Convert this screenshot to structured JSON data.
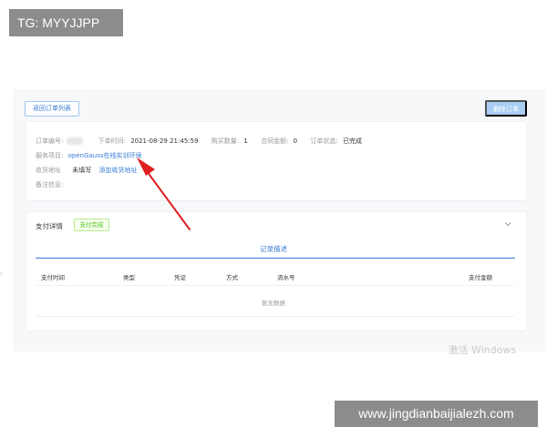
{
  "overlay": {
    "tg_label": "TG: MYYJJPP",
    "url_label": "www.jingdianbaijialezh.com",
    "windows_watermark": "激活 Windows"
  },
  "header": {
    "back_button": "返回订单列表",
    "delete_button": "删除订单"
  },
  "order": {
    "order_no_label": "订单编号:",
    "order_time_label": "下单时间:",
    "order_time_value": "2021-08-29 21:45:59",
    "purchase_qty_label": "购买数量:",
    "purchase_qty_value": "1",
    "contract_amount_label": "合同金额:",
    "contract_amount_value": "0",
    "order_status_label": "订单状态:",
    "order_status_value": "已完成",
    "service_label": "服务项目:",
    "service_value": "openGauss在线实训环境",
    "address_label": "收货地址",
    "address_value": "未填写",
    "address_link": "添加收货地址",
    "remark_label": "备注信息:"
  },
  "payment": {
    "title": "支付详情",
    "status_badge": "支付完成",
    "tab_label": "记录描述",
    "columns": [
      "支付时间",
      "类型",
      "凭证",
      "方式",
      "流水号",
      "支付金额"
    ],
    "empty_text": "暂无数据"
  },
  "colors": {
    "accent": "#3a7bd5",
    "success": "#52c41a",
    "arrow": "#e02020"
  }
}
